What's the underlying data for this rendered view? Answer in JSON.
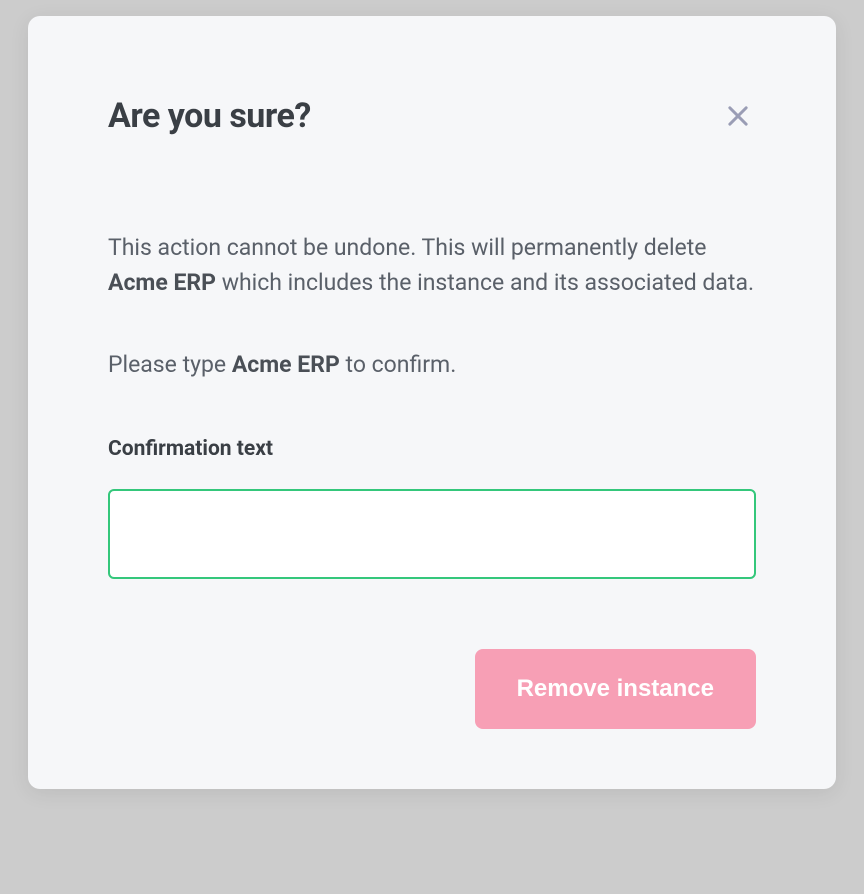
{
  "modal": {
    "title": "Are you sure?",
    "warning_prefix": "This action cannot be undone. This will permanently delete ",
    "instance_name": "Acme ERP",
    "warning_suffix": " which includes the instance and its associated data.",
    "confirm_prefix": "Please type ",
    "confirm_suffix": " to confirm.",
    "field_label": "Confirmation text",
    "input_value": "",
    "remove_label": "Remove instance"
  }
}
